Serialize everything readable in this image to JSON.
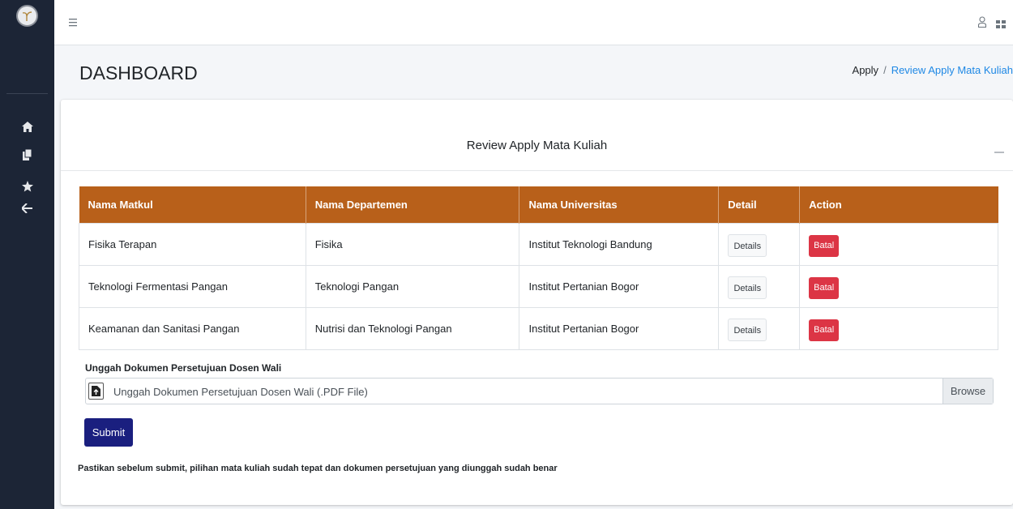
{
  "topbar": {
    "icons": {
      "menu": "hamburger-icon",
      "user": "user-icon",
      "apps": "grid-icon"
    }
  },
  "sidebar": {
    "logo": "app-logo",
    "items": [
      {
        "icon": "home-icon"
      },
      {
        "icon": "documents-icon"
      },
      {
        "icon": "star-icon"
      },
      {
        "icon": "arrow-left-icon"
      }
    ]
  },
  "header": {
    "title": "DASHBOARD",
    "breadcrumb": {
      "home": "Apply",
      "separator": "/",
      "current": "Review Apply Mata Kuliah"
    }
  },
  "card": {
    "title": "Review Apply Mata Kuliah",
    "table": {
      "headers": [
        "Nama Matkul",
        "Nama Departemen",
        "Nama Universitas",
        "Detail",
        "Action"
      ],
      "rows": [
        {
          "matkul": "Fisika Terapan",
          "departemen": "Fisika",
          "universitas": "Institut Teknologi Bandung",
          "detail": "Details",
          "action": "Batal"
        },
        {
          "matkul": "Teknologi Fermentasi Pangan",
          "departemen": "Teknologi Pangan",
          "universitas": "Institut Pertanian Bogor",
          "detail": "Details",
          "action": "Batal"
        },
        {
          "matkul": "Keamanan dan Sanitasi Pangan",
          "departemen": "Nutrisi dan Teknologi Pangan",
          "universitas": "Institut Pertanian Bogor",
          "detail": "Details",
          "action": "Batal"
        }
      ]
    },
    "upload": {
      "label": "Unggah Dokumen Persetujuan Dosen Wali",
      "placeholder": "Unggah Dokumen Persetujuan Dosen Wali (.PDF File)",
      "browse": "Browse"
    },
    "submit": "Submit",
    "note": "Pastikan sebelum submit, pilihan mata kuliah sudah tepat dan dokumen persetujuan yang diunggah sudah benar"
  },
  "colors": {
    "sidebar_bg": "#1c2536",
    "table_header": "#b8601a",
    "danger": "#dc3545",
    "submit": "#1a1f7f",
    "link": "#1e88e5"
  }
}
